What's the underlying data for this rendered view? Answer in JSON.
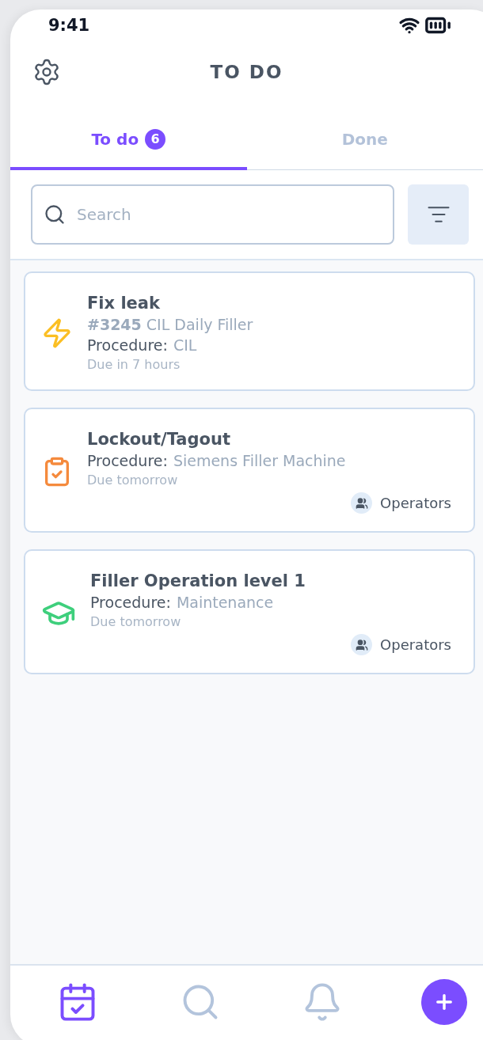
{
  "status_bar": {
    "time": "9:41"
  },
  "header": {
    "title": "TO DO"
  },
  "tabs": [
    {
      "label": "To do",
      "badge": "6",
      "selected": true
    },
    {
      "label": "Done",
      "selected": false
    }
  ],
  "search": {
    "placeholder": "Search"
  },
  "tasks": [
    {
      "kind": "bolt",
      "title": "Fix leak",
      "reference": "**#3245** CIL Daily Filler",
      "procedure_label": "Procedure:",
      "procedure": "CIL",
      "due": "Due in 7 hours"
    },
    {
      "kind": "clipboard",
      "title": "Lockout/Tagout",
      "procedure_label": "Procedure:",
      "procedure": "Siemens Filler Machine",
      "due": "Due tomorrow",
      "assignee": "Operators"
    },
    {
      "kind": "cap",
      "title": "Filler Operation level 1",
      "procedure_label": "Procedure:",
      "procedure": "Maintenance",
      "due": "Due tomorrow",
      "assignee": "Operators"
    }
  ],
  "bottom_nav": [
    {
      "kind": "calendar",
      "selected": true
    },
    {
      "kind": "search",
      "selected": false
    },
    {
      "kind": "bell",
      "selected": false
    }
  ]
}
